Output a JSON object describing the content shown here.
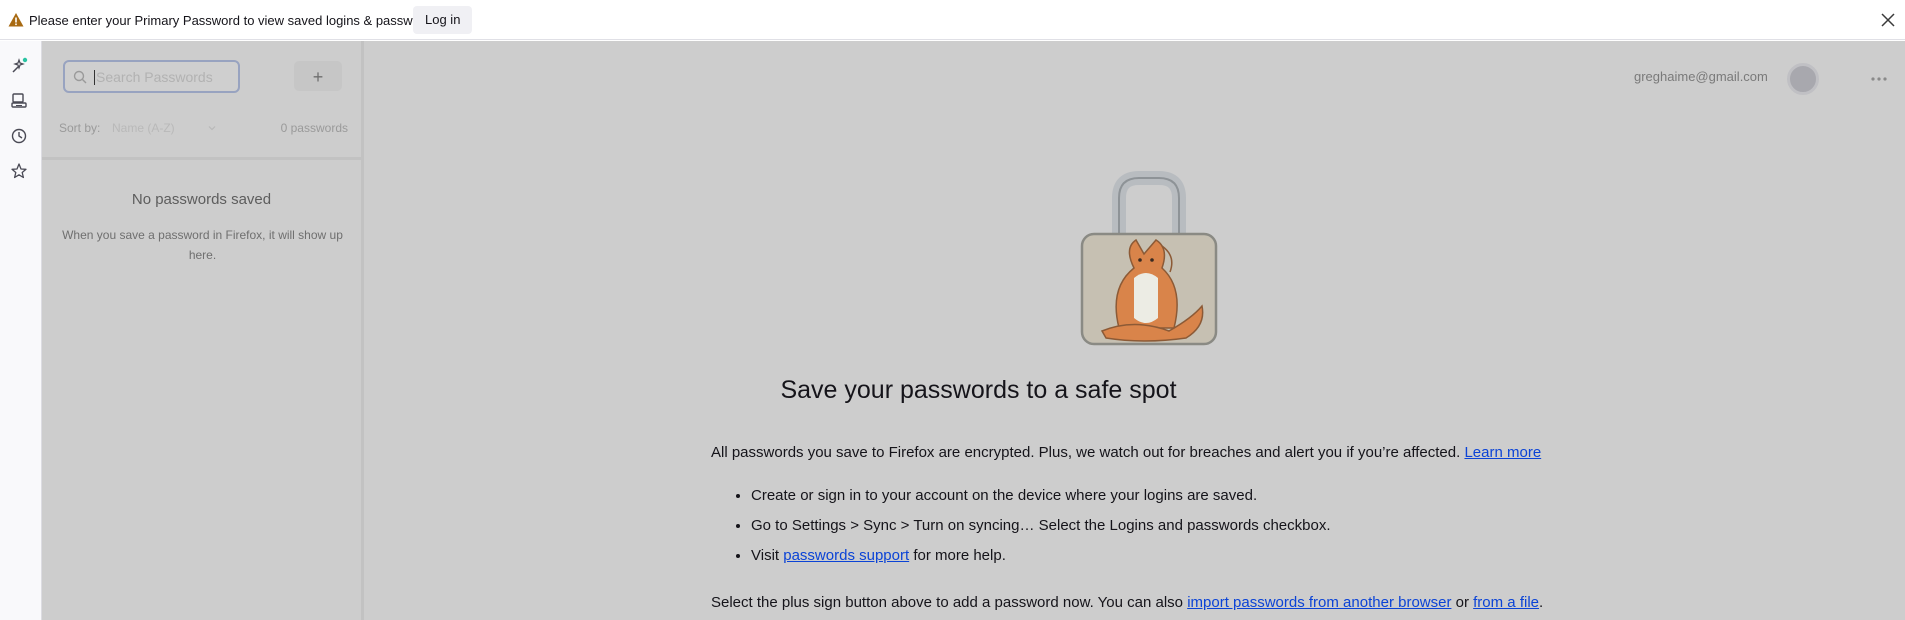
{
  "notification": {
    "message": "Please enter your Primary Password to view saved logins & passwords",
    "login_button": "Log in",
    "warn_icon": "warning-icon",
    "close_icon": "close-icon"
  },
  "sidebar_strip": {
    "icons": [
      "ai-chatbot-icon",
      "synced-tabs-icon",
      "history-icon",
      "bookmarks-icon"
    ]
  },
  "list_pane": {
    "search": {
      "placeholder": "Search Passwords",
      "value": ""
    },
    "add_button": "+",
    "sort_label": "Sort by:",
    "sort_value": "Name (A-Z)",
    "count": "0 passwords",
    "empty_title": "No passwords saved",
    "empty_description": "When you save a password in Firefox, it will show up here."
  },
  "header": {
    "account_email": "greghaime@gmail.com",
    "menu_icon": "more-icon"
  },
  "main": {
    "headline": "Save your passwords to a safe spot",
    "intro_text": "All passwords you save to Firefox are encrypted. Plus, we watch out for breaches and alert you if you’re affected.",
    "intro_link": "Learn more",
    "steps": {
      "step1": "Create or sign in to your account on the device where your logins are saved.",
      "step2": "Go to Settings > Sync > Turn on syncing… Select the Logins and passwords checkbox.",
      "step3_prefix": "Visit",
      "step3_link": "passwords support",
      "step3_suffix": "for more help."
    },
    "footer": {
      "text_before": "Select the plus sign button above to add a password now. You can also",
      "link1": "import passwords from another browser",
      "or": "or",
      "link2": "from a file",
      "end": "."
    }
  },
  "colors": {
    "overlay_bg": "#cdcdcd",
    "link": "#0b43d6",
    "warning": "#b06a00"
  }
}
